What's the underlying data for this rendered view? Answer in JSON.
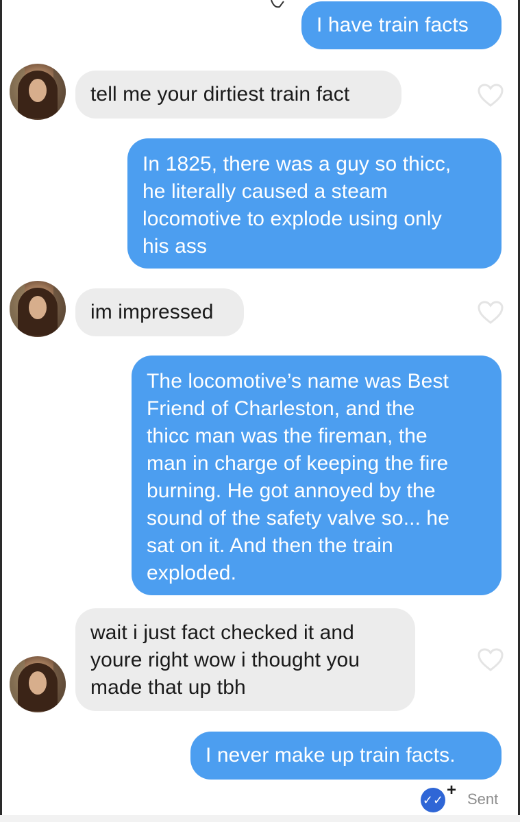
{
  "messages": [
    {
      "from": "me",
      "text": "I have train facts"
    },
    {
      "from": "them",
      "text": "tell me your dirtiest train fact"
    },
    {
      "from": "me",
      "lines": [
        "In 1825, there was a guy so thicc,",
        "he literally caused a steam",
        "locomotive to explode using only",
        "his ass"
      ]
    },
    {
      "from": "them",
      "text": "im impressed"
    },
    {
      "from": "me",
      "lines": [
        "The locomotive’s name was Best",
        "Friend of Charleston, and the",
        "thicc man was the fireman, the",
        "man in charge of keeping the fire",
        "burning. He got annoyed by the",
        "sound of the safety valve so... he",
        "sat on it. And then the train",
        "exploded."
      ]
    },
    {
      "from": "them",
      "lines": [
        "wait i just fact checked it and",
        "youre right wow i thought you",
        "made that up tbh"
      ]
    },
    {
      "from": "me",
      "text": "I never make up train facts."
    }
  ],
  "status": {
    "check": "✓✓",
    "plus": "+",
    "label": "Sent"
  },
  "colors": {
    "sent_bubble": "#4c9ef0",
    "received_bubble": "#ececec",
    "check_badge": "#2f66d6"
  },
  "icons": {
    "like": "heart-outline-icon",
    "read_receipt": "double-check-icon",
    "avatar": "avatar"
  }
}
